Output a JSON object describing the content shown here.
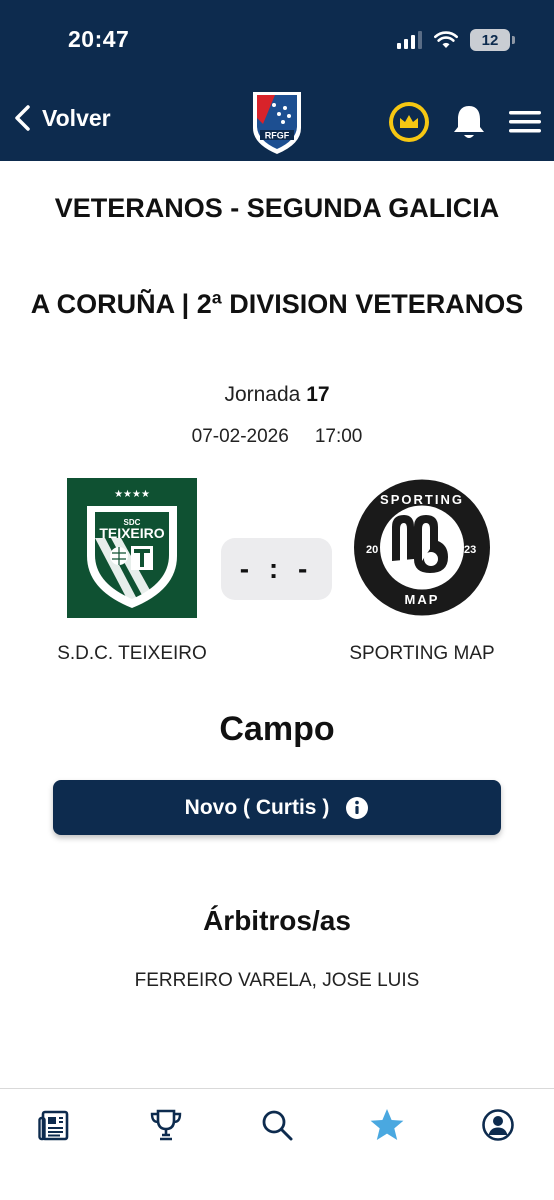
{
  "status_bar": {
    "time": "20:47",
    "battery": "12"
  },
  "header": {
    "back_label": "Volver",
    "logo_text": "RFGF"
  },
  "match": {
    "competition": "VETERANOS - SEGUNDA GALICIA",
    "division": "A CORUÑA | 2ª DIVISION VETERANOS",
    "jornada_label": "Jornada",
    "jornada_number": "17",
    "date": "07-02-2026",
    "time": "17:00",
    "score": "- : -",
    "home_team": {
      "name": "S.D.C. TEIXEIRO",
      "logo_top": "SDC",
      "logo_name": "TEIXEIRO",
      "logo_stars": "★★★★"
    },
    "away_team": {
      "name": "SPORTING MAP",
      "logo_top": "SPORTING",
      "logo_bottom": "MAP",
      "logo_left": "20",
      "logo_right": "23"
    }
  },
  "venue": {
    "section_title": "Campo",
    "name": "Novo ( Curtis )"
  },
  "referees": {
    "section_title": "Árbitros/as",
    "names": "FERREIRO VARELA, JOSE LUIS"
  },
  "colors": {
    "primary": "#0d2b4e",
    "accent": "#f6c712",
    "active_nav": "#4aa8e0",
    "home_green": "#0f5132"
  },
  "bottom_nav": [
    {
      "icon": "news-icon",
      "active": false
    },
    {
      "icon": "trophy-icon",
      "active": false
    },
    {
      "icon": "search-icon",
      "active": false
    },
    {
      "icon": "star-icon",
      "active": true
    },
    {
      "icon": "user-icon",
      "active": false
    }
  ]
}
